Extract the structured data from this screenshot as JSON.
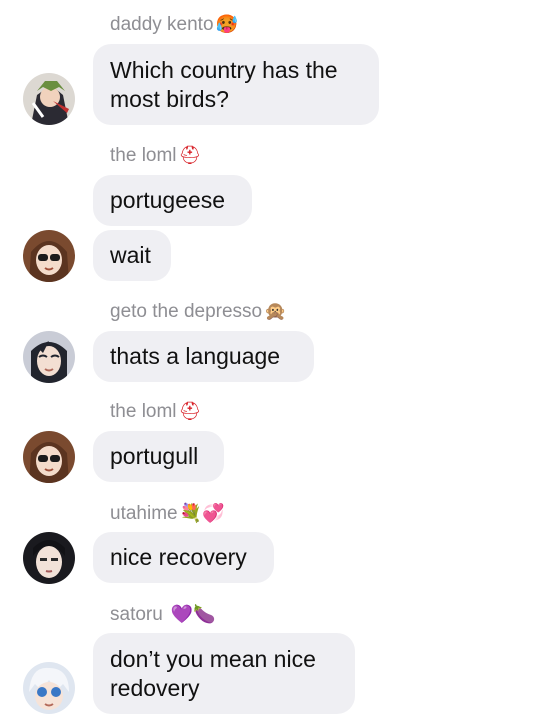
{
  "messages": [
    {
      "sender": "daddy kento",
      "sender_emoji": "🥵",
      "text": "Which country has the\nmost birds?",
      "avatar": "avatar-kento"
    },
    {
      "sender": "the loml",
      "sender_emoji": "⛑",
      "text": "portugeese",
      "avatar": ""
    },
    {
      "sender": "",
      "sender_emoji": "",
      "text": "wait",
      "avatar": "avatar-loml"
    },
    {
      "sender": "geto the depresso",
      "sender_emoji": "🙊",
      "text": "thats a language",
      "avatar": "avatar-geto"
    },
    {
      "sender": "the loml",
      "sender_emoji": "⛑",
      "text": "portugull",
      "avatar": "avatar-loml"
    },
    {
      "sender": "utahime",
      "sender_emoji": "💐💞",
      "text": "nice recovery",
      "avatar": "avatar-utahime"
    },
    {
      "sender": "satoru",
      "sender_emoji": "💜🍆",
      "text": "don’t you mean nice\nredovery",
      "avatar": "avatar-satoru"
    }
  ],
  "colors": {
    "bubble": "#efeff3",
    "sender_name": "#8e8e93",
    "text": "#111111",
    "background": "#ffffff"
  }
}
